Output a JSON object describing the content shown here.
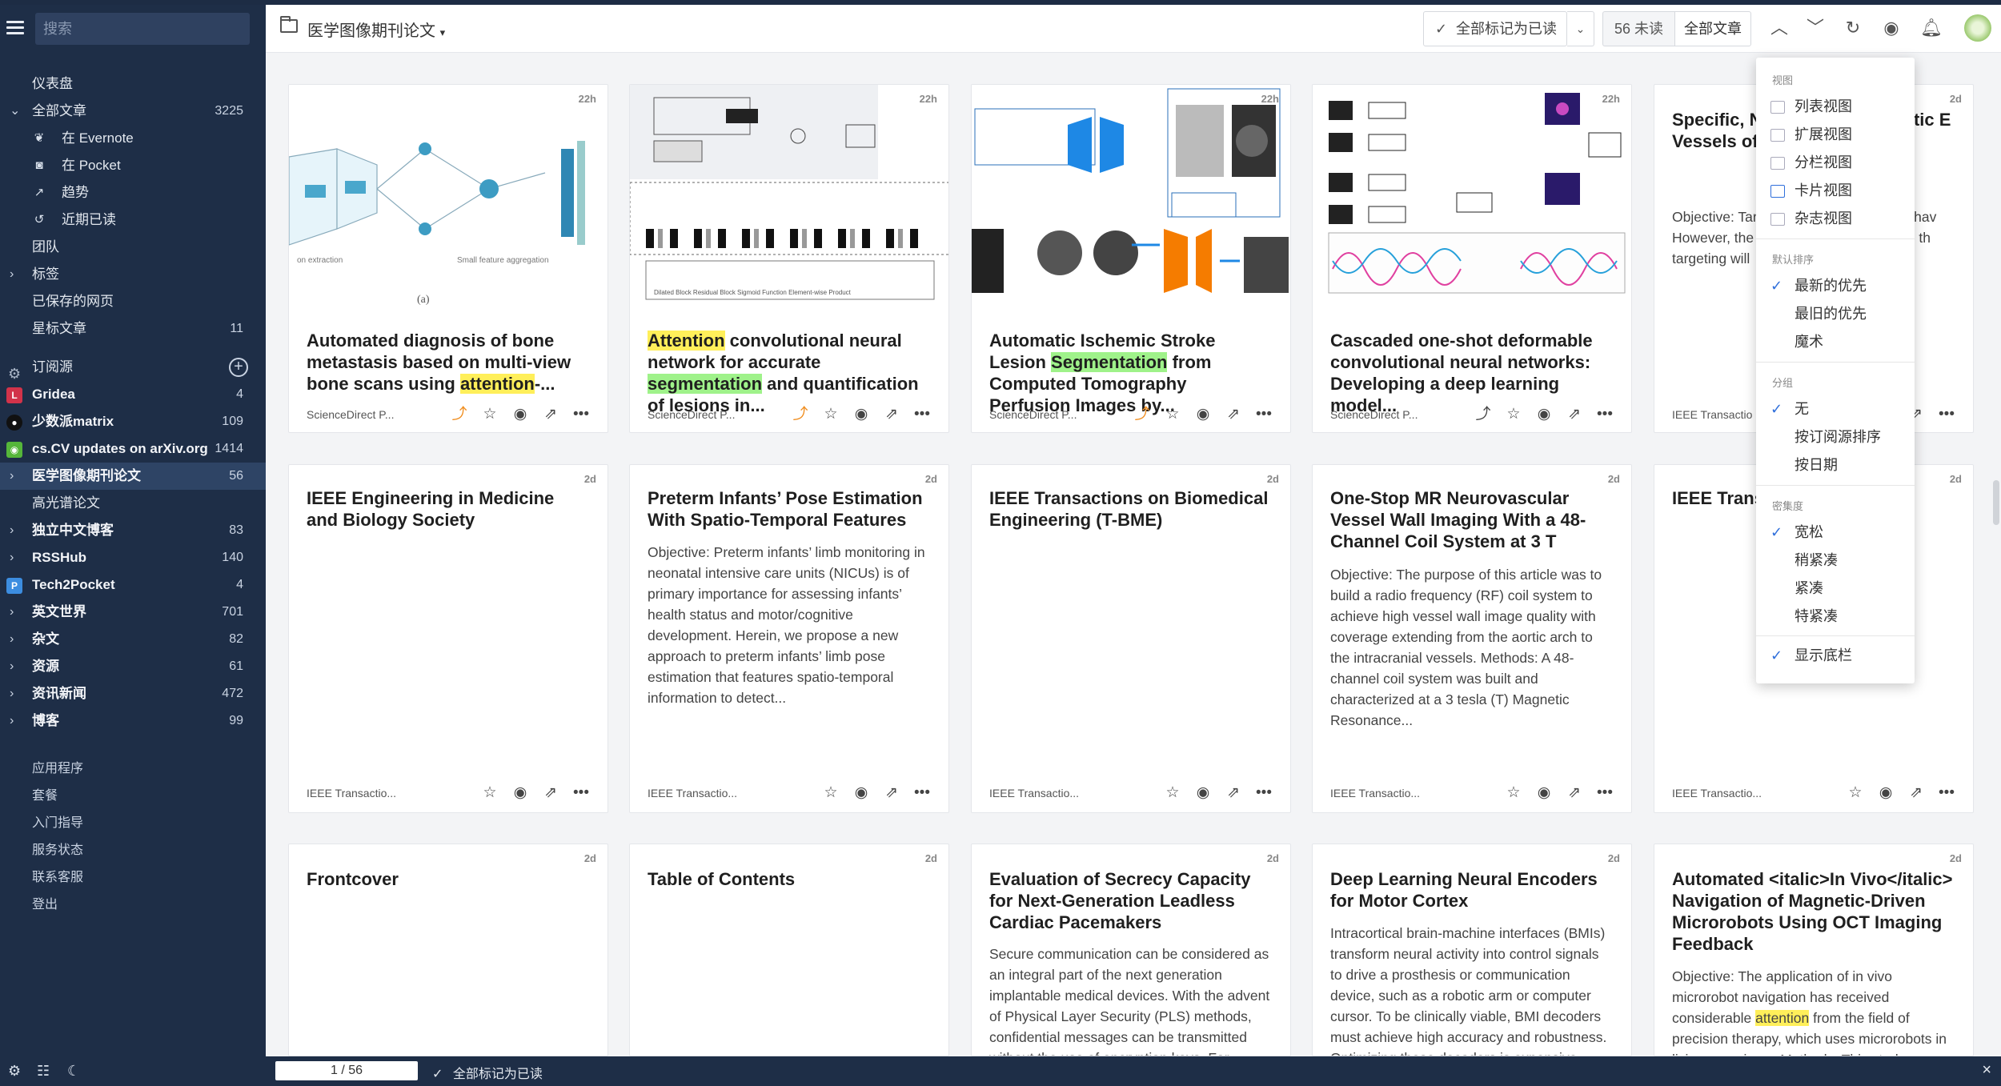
{
  "sidebar": {
    "search_placeholder": "搜索",
    "nav": [
      {
        "label": "仪表盘"
      },
      {
        "label": "全部文章",
        "count": "3225"
      },
      {
        "label": "在 Evernote"
      },
      {
        "label": "在 Pocket"
      },
      {
        "label": "趋势"
      },
      {
        "label": "近期已读"
      },
      {
        "label": "团队"
      },
      {
        "label": "标签"
      },
      {
        "label": "已保存的网页"
      },
      {
        "label": "星标文章",
        "count": "11"
      }
    ],
    "subscriptions_label": "订阅源",
    "feeds": [
      {
        "label": "Gridea",
        "count": "4",
        "icon": "L",
        "color": "#d2334a"
      },
      {
        "label": "少数派matrix",
        "count": "109",
        "icon": "github-icon",
        "color": "#222"
      },
      {
        "label": "cs.CV updates on arXiv.org",
        "count": "1414",
        "icon": "rss",
        "color": "#55b63a"
      },
      {
        "label": "医学图像期刊论文",
        "count": "56"
      },
      {
        "label": "高光谱论文",
        "count": ""
      },
      {
        "label": "独立中文博客",
        "count": "83"
      },
      {
        "label": "RSSHub",
        "count": "140"
      },
      {
        "label": "Tech2Pocket",
        "count": "4",
        "icon": "P",
        "color": "#3c8de0"
      },
      {
        "label": "英文世界",
        "count": "701"
      },
      {
        "label": "杂文",
        "count": "82"
      },
      {
        "label": "资源",
        "count": "61"
      },
      {
        "label": "资讯新闻",
        "count": "472"
      },
      {
        "label": "博客",
        "count": "99"
      }
    ],
    "bottom": [
      {
        "label": "应用程序"
      },
      {
        "label": "套餐"
      },
      {
        "label": "入门指导"
      },
      {
        "label": "服务状态"
      },
      {
        "label": "联系客服"
      },
      {
        "label": "登出"
      }
    ]
  },
  "header": {
    "title": "医学图像期刊论文",
    "mark_all_read": "全部标记为已读",
    "unread_label": "56 未读",
    "all_label": "全部文章"
  },
  "status": {
    "pager": "1 / 56",
    "mark_all_read": "全部标记为已读"
  },
  "cards": [
    {
      "age": "22h",
      "title_html": "Automated diagnosis of bone metastasis based on multi-view bone scans using <span class=\"hl-y\">attention</span>-...",
      "source": "ScienceDirect P...",
      "thumb": "net1"
    },
    {
      "age": "22h",
      "title_html": "<span class=\"hl-y\">Attention</span> convolutional neural network for accurate <span class=\"hl-g\">segmentation</span> and quantification of lesions in...",
      "source": "ScienceDirect P...",
      "thumb": "net2"
    },
    {
      "age": "22h",
      "title_html": "Automatic Ischemic Stroke Lesion <span class=\"hl-g\">Segmentation</span> from Computed Tomography Perfusion Images by...",
      "source": "ScienceDirect P...",
      "thumb": "net3"
    },
    {
      "age": "22h",
      "title_html": "Cascaded one-shot deformable convolutional neural networks: Developing a deep learning model...",
      "source": "ScienceDirect P...",
      "thumb": "net4"
    },
    {
      "age": "2d",
      "title": "Specific, N Magnetica Magnetic E Vessels of",
      "snippet": "Objective: Tar spotlight for p strategies hav However, the strategies cur It has been th targeting will",
      "source": "IEEE Transactio"
    },
    {
      "age": "2d",
      "title": "IEEE Engineering in Medicine and Biology Society",
      "snippet": "",
      "source": "IEEE Transactio..."
    },
    {
      "age": "2d",
      "title": "Preterm Infants’ Pose Estimation With Spatio-Temporal Features",
      "snippet": "Objective: Preterm infants’ limb monitoring in neonatal intensive care units (NICUs) is of primary importance for assessing infants’ health status and motor/cognitive development. Herein, we propose a new approach to preterm infants’ limb pose estimation that features spatio-temporal information to detect...",
      "source": "IEEE Transactio..."
    },
    {
      "age": "2d",
      "title": "IEEE Transactions on Biomedical Engineering (T-BME)",
      "snippet": "",
      "source": "IEEE Transactio..."
    },
    {
      "age": "2d",
      "title": "One-Stop MR Neurovascular Vessel Wall Imaging With a 48-Channel Coil System at 3 T",
      "snippet": "Objective: The purpose of this article was to build a radio frequency (RF) coil system to achieve high vessel wall image quality with coverage extending from the aortic arch to the intracranial vessels. Methods: A 48-channel coil system was built and characterized at a 3 tesla (T) Magnetic Resonance...",
      "source": "IEEE Transactio..."
    },
    {
      "age": "2d",
      "title": "IEEE Trans Engineerin",
      "snippet": "",
      "source": "IEEE Transactio..."
    },
    {
      "age": "2d",
      "title": "Frontcover",
      "snippet": ""
    },
    {
      "age": "2d",
      "title": "Table of Contents",
      "snippet": ""
    },
    {
      "age": "2d",
      "title": "Evaluation of Secrecy Capacity for Next-Generation Leadless Cardiac Pacemakers",
      "snippet": "Secure communication can be considered as an integral part of the next generation implantable medical devices. With the advent of Physical Layer Security (PLS) methods, confidential messages can be transmitted without the use of encryption keys. For..."
    },
    {
      "age": "2d",
      "title": "Deep Learning Neural Encoders for Motor Cortex",
      "snippet": "Intracortical brain-machine interfaces (BMIs) transform neural activity into control signals to drive a prosthesis or communication device, such as a robotic arm or computer cursor. To be clinically viable, BMI decoders must achieve high accuracy and robustness. Optimizing these decoders is expensive..."
    },
    {
      "age": "2d",
      "title": "Automated <italic>In Vivo</italic> Navigation of Magnetic-Driven Microrobots Using OCT Imaging Feedback",
      "snippet_html": "Objective: The application of in vivo microrobot navigation has received considerable <span class=\"hl-y\">attention</span> from the field of precision therapy, which uses microrobots in living organisms. Methods: This study..."
    }
  ],
  "menu": {
    "view_header": "视图",
    "views": [
      "列表视图",
      "扩展视图",
      "分栏视图",
      "卡片视图",
      "杂志视图"
    ],
    "sort_header": "默认排序",
    "sorts": [
      "最新的优先",
      "最旧的优先",
      "魔术"
    ],
    "group_header": "分组",
    "groups": [
      "无",
      "按订阅源排序",
      "按日期"
    ],
    "density_header": "密集度",
    "densities": [
      "宽松",
      "稍紧凑",
      "紧凑",
      "特紧凑"
    ],
    "footer_toggle": "显示底栏"
  },
  "colors": {
    "sidebar_bg": "#1e2e47",
    "accent": "#2f6fdb",
    "highlight_yellow": "#ffef5a",
    "highlight_green": "#9ff28a"
  }
}
